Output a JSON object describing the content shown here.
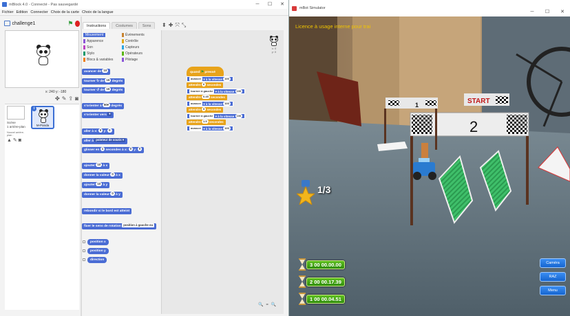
{
  "mblock": {
    "window_title": "mBlock 4.0 - Connecté - Pas sauvegardé",
    "menu": [
      "Fichier",
      "Edition",
      "Connecter",
      "Choix de la carte",
      "Choix de la langue"
    ],
    "sprite_name": "challenge1",
    "coords": "x: 240  y: -180",
    "scene_label": "Scène",
    "scene_sub": "1 arrière-plan",
    "new_bg_label": "Nouvel arrière-plan :",
    "sprite_thumb_label": "M-Panda",
    "tabs": [
      "Instructions",
      "Costumes",
      "Sons"
    ],
    "categories": {
      "left": [
        "Mouvement",
        "Apparence",
        "Son",
        "Stylo",
        "Blocs & variables"
      ],
      "right": [
        "Évènements",
        "Contrôle",
        "Capteurs",
        "Opérateurs",
        "Pilotage"
      ]
    },
    "blocks": {
      "b1": "avancer de",
      "b1v": "10",
      "b2a": "tourner",
      "b2b": "de",
      "b2c": "degrés",
      "b2v": "15",
      "b3a": "tourner",
      "b3b": "de",
      "b3c": "degrés",
      "b3v": "15",
      "b4a": "s'orienter à",
      "b4v": "90▾",
      "b4b": "degrés",
      "b5a": "s'orienter vers",
      "b5d": "▾",
      "b6a": "aller à x:",
      "b6v1": "0",
      "b6b": "y:",
      "b6v2": "0",
      "b7a": "aller à",
      "b7d": "pointeur de souris ▾",
      "b8a": "glisser en",
      "b8v1": "1",
      "b8b": "secondes à x:",
      "b8v2": "0",
      "b8c": "y:",
      "b8v3": "0",
      "b9a": "ajouter",
      "b9v": "10",
      "b9b": "à x",
      "b10a": "donner la valeur",
      "b10v": "0",
      "b10b": "à x",
      "b11a": "ajouter",
      "b11v": "10",
      "b11b": "à y",
      "b12a": "donner la valeur",
      "b12v": "0",
      "b12b": "à y",
      "b13": "rebondir si le bord est atteint",
      "b14a": "fixer le sens de rotation",
      "b14d": "position à gauche ou",
      "r1": "position x",
      "r2": "position y",
      "r3": "direction"
    },
    "script": {
      "hat": "quand",
      "hat2": "pressé",
      "l1a": "avancer",
      "l1b": "à la vitesse",
      "l1v": "100",
      "l2a": "attendre",
      "l2v": "6",
      "l2b": "secondes",
      "l3a": "tourner à gauche",
      "l3b": "à la vitesse",
      "l3v": "100",
      "l4a": "attendre",
      "l4v": "0.45",
      "l4b": "secondes",
      "l5a": "avancer",
      "l5b": "à la vitesse",
      "l5v": "100",
      "l6a": "attendre",
      "l6v": "5",
      "l6b": "secondes",
      "l7a": "tourner à gauche",
      "l7b": "à la vitesse",
      "l7v": "100",
      "l8a": "attendre",
      "l8v": "1.5",
      "l8b": "secondes",
      "l9a": "avancer",
      "l9b": "à la vitesse",
      "l9v": "100"
    },
    "sprite_corner": "x: 0\ny: 0"
  },
  "simulator": {
    "window_title": "mBot Simulator",
    "license": "Licence à usage interne pour trai",
    "lap_count": "1/3",
    "lap_times": [
      {
        "n": "3",
        "time": "00 00.00.00"
      },
      {
        "n": "2",
        "time": "00 00.17.39"
      },
      {
        "n": "1",
        "time": "00 00.04.51"
      }
    ],
    "buttons": [
      "Caméra",
      "RAZ",
      "Menu"
    ],
    "banner_number": "2",
    "start_text": "START",
    "gate_number": "1"
  }
}
